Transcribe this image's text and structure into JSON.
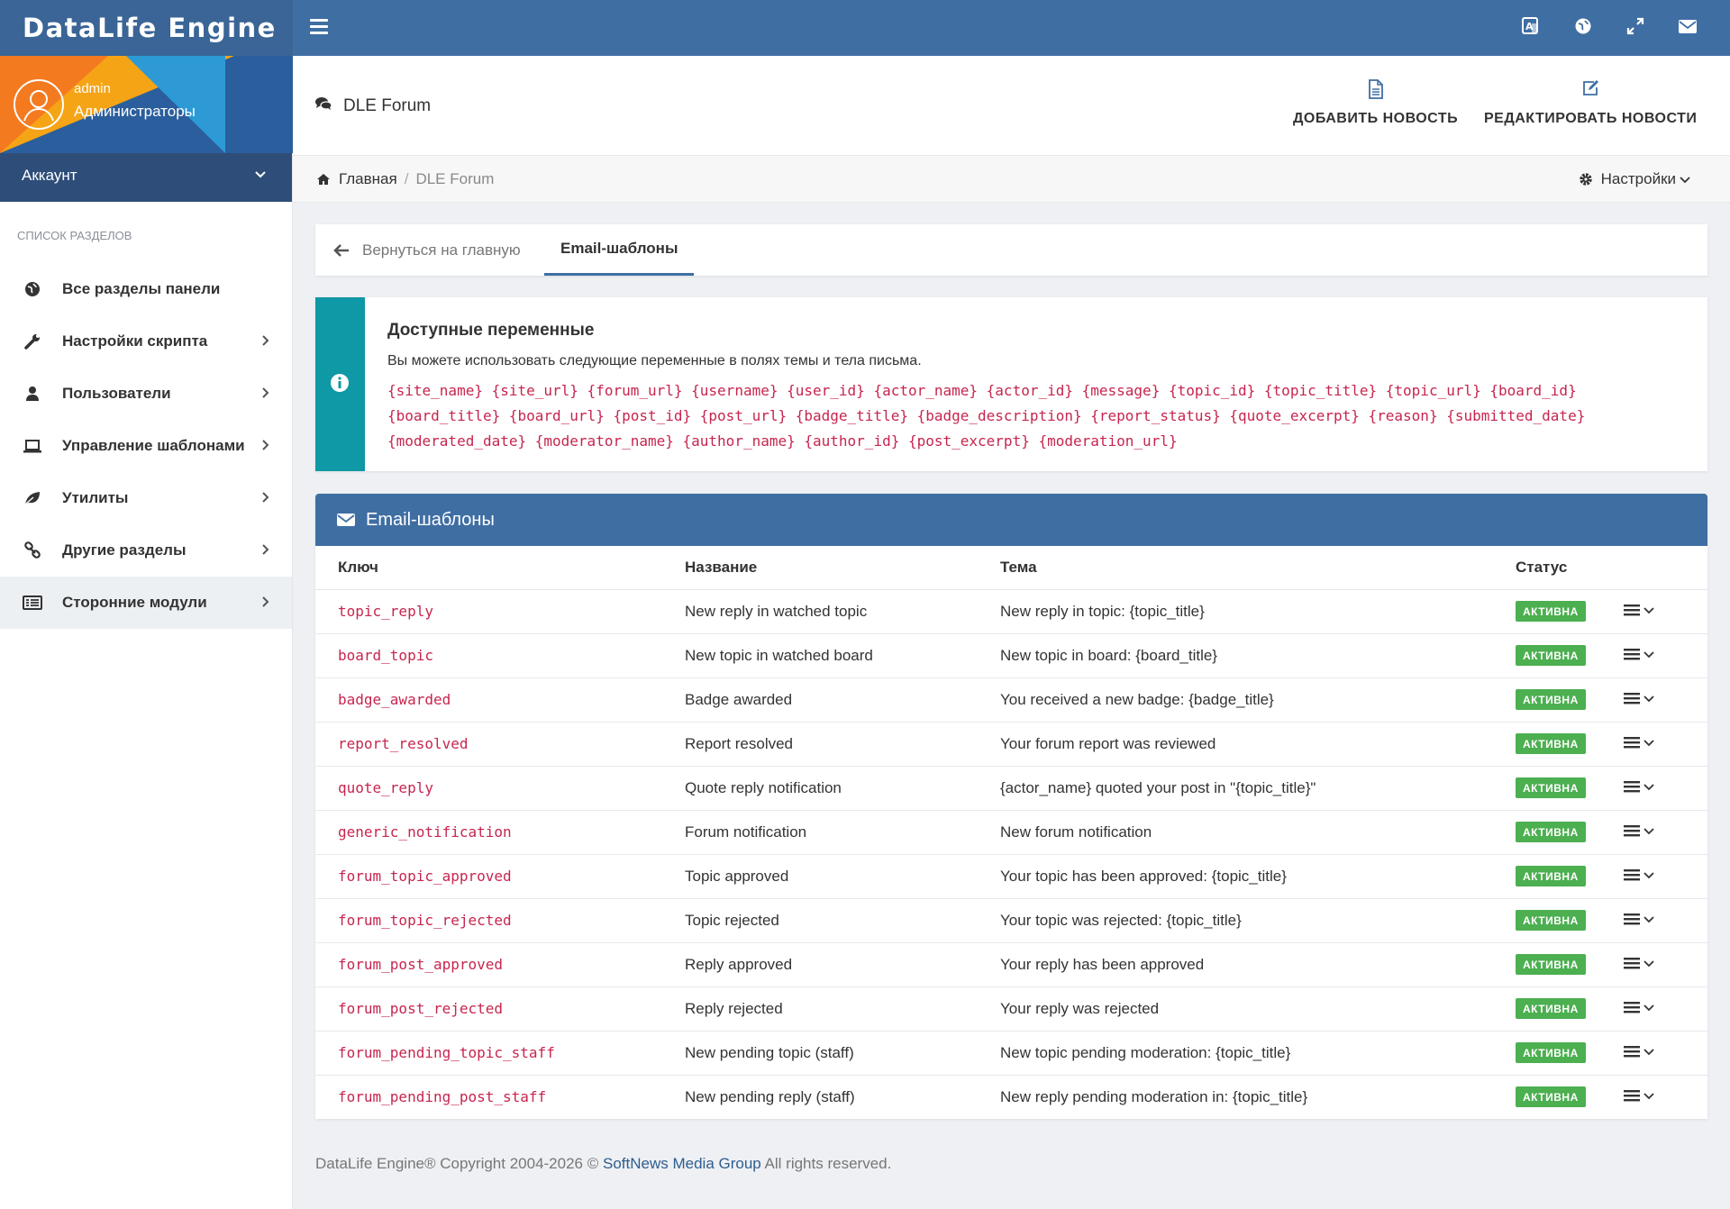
{
  "app": {
    "brand": "DataLife Engine",
    "accent_color": "#3f6ea3",
    "badge_color": "#4caf50",
    "key_color": "#c7254e"
  },
  "topbar": {
    "icons": [
      "language-icon",
      "globe-icon",
      "fullscreen-icon",
      "envelope-icon"
    ]
  },
  "user": {
    "name": "admin",
    "group": "Администраторы",
    "account_label": "Аккаунт"
  },
  "sidebar": {
    "header": "Список разделов",
    "items": [
      {
        "label": "Все разделы панели",
        "icon": "globe-icon",
        "has_arrow": false
      },
      {
        "label": "Настройки скрипта",
        "icon": "wrench-icon",
        "has_arrow": true
      },
      {
        "label": "Пользователи",
        "icon": "user-icon",
        "has_arrow": true
      },
      {
        "label": "Управление шаблонами",
        "icon": "laptop-icon",
        "has_arrow": true
      },
      {
        "label": "Утилиты",
        "icon": "leaf-icon",
        "has_arrow": true
      },
      {
        "label": "Другие разделы",
        "icon": "link-icon",
        "has_arrow": true
      },
      {
        "label": "Сторонние модули",
        "icon": "list-icon",
        "has_arrow": true,
        "active": true
      }
    ]
  },
  "header": {
    "title": "DLE Forum",
    "add_news": "ДОБАВИТЬ НОВОСТЬ",
    "edit_news": "РЕДАКТИРОВАТЬ НОВОСТИ"
  },
  "breadcrumb": {
    "home": "Главная",
    "separator": "/",
    "current": "DLE Forum",
    "settings": "Настройки"
  },
  "tabs": {
    "back": "Вернуться на главную",
    "active": "Email-шаблоны"
  },
  "alert": {
    "title": "Доступные переменные",
    "description": "Вы можете использовать следующие переменные в полях темы и тела письма.",
    "variables": "{site_name} {site_url} {forum_url} {username} {user_id} {actor_name} {actor_id} {message} {topic_id} {topic_title} {topic_url} {board_id} {board_title} {board_url} {post_id} {post_url} {badge_title} {badge_description} {report_status} {quote_excerpt} {reason} {submitted_date} {moderated_date} {moderator_name} {author_name} {author_id} {post_excerpt} {moderation_url}"
  },
  "panel": {
    "title": "Email-шаблоны",
    "columns": [
      "Ключ",
      "Название",
      "Тема",
      "Статус"
    ],
    "rows": [
      {
        "key": "topic_reply",
        "name": "New reply in watched topic",
        "subject": "New reply in topic: {topic_title}",
        "status": "АКТИВНА"
      },
      {
        "key": "board_topic",
        "name": "New topic in watched board",
        "subject": "New topic in board: {board_title}",
        "status": "АКТИВНА"
      },
      {
        "key": "badge_awarded",
        "name": "Badge awarded",
        "subject": "You received a new badge: {badge_title}",
        "status": "АКТИВНА"
      },
      {
        "key": "report_resolved",
        "name": "Report resolved",
        "subject": "Your forum report was reviewed",
        "status": "АКТИВНА"
      },
      {
        "key": "quote_reply",
        "name": "Quote reply notification",
        "subject": "{actor_name} quoted your post in \"{topic_title}\"",
        "status": "АКТИВНА"
      },
      {
        "key": "generic_notification",
        "name": "Forum notification",
        "subject": "New forum notification",
        "status": "АКТИВНА"
      },
      {
        "key": "forum_topic_approved",
        "name": "Topic approved",
        "subject": "Your topic has been approved: {topic_title}",
        "status": "АКТИВНА"
      },
      {
        "key": "forum_topic_rejected",
        "name": "Topic rejected",
        "subject": "Your topic was rejected: {topic_title}",
        "status": "АКТИВНА"
      },
      {
        "key": "forum_post_approved",
        "name": "Reply approved",
        "subject": "Your reply has been approved",
        "status": "АКТИВНА"
      },
      {
        "key": "forum_post_rejected",
        "name": "Reply rejected",
        "subject": "Your reply was rejected",
        "status": "АКТИВНА"
      },
      {
        "key": "forum_pending_topic_staff",
        "name": "New pending topic (staff)",
        "subject": "New topic pending moderation: {topic_title}",
        "status": "АКТИВНА"
      },
      {
        "key": "forum_pending_post_staff",
        "name": "New pending reply (staff)",
        "subject": "New reply pending moderation in: {topic_title}",
        "status": "АКТИВНА"
      }
    ]
  },
  "footer": {
    "prefix": "DataLife Engine® Copyright 2004-2026 ©",
    "link": "SoftNews Media Group",
    "suffix": "All rights reserved."
  }
}
